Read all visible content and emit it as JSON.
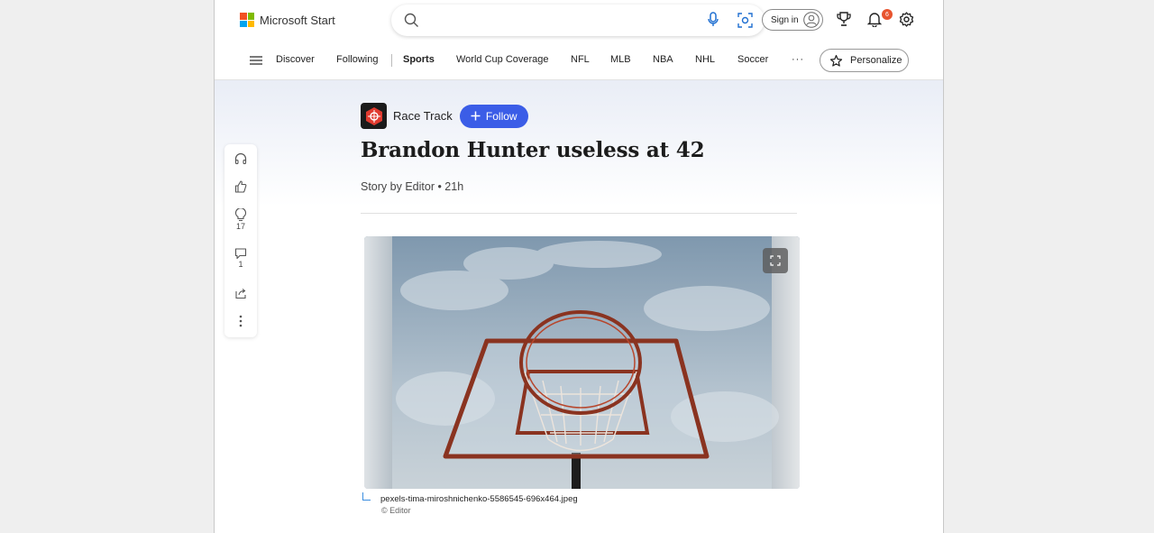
{
  "header": {
    "brand": "Microsoft Start",
    "search_placeholder": "",
    "signin_label": "Sign in",
    "notification_count": "6"
  },
  "nav": {
    "items": [
      {
        "label": "Discover"
      },
      {
        "label": "Following"
      },
      {
        "label": "Sports",
        "active": true
      },
      {
        "label": "World Cup Coverage"
      },
      {
        "label": "NFL"
      },
      {
        "label": "MLB"
      },
      {
        "label": "NBA"
      },
      {
        "label": "NHL"
      },
      {
        "label": "Soccer"
      }
    ],
    "more_label": "···",
    "personalize_label": "Personalize"
  },
  "rail": {
    "likes_count": "",
    "dislike_count": "17",
    "comment_count": "1"
  },
  "article": {
    "publisher": "Race Track",
    "follow_label": "Follow",
    "title": "Brandon Hunter useless at 42",
    "byline": "Story by Editor • 21h",
    "image_caption": "pexels-tima-miroshnichenko-5586545-696x464.jpeg",
    "image_credit": "© Editor"
  },
  "colors": {
    "accent": "#3b5de7",
    "badge": "#e8542f"
  }
}
